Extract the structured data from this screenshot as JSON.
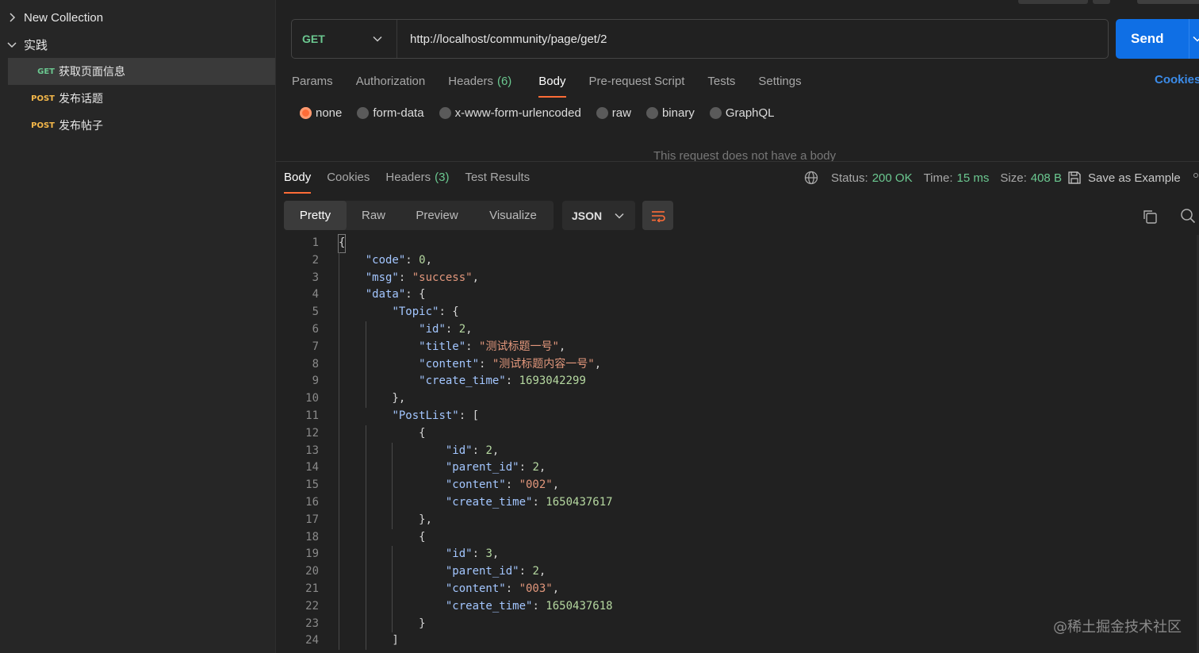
{
  "sidebar": {
    "collections": [
      {
        "label": "New Collection",
        "expanded": false
      },
      {
        "label": "实践",
        "expanded": true
      }
    ],
    "requests": [
      {
        "method": "GET",
        "name": "获取页面信息",
        "active": true
      },
      {
        "method": "POST",
        "name": "发布话题",
        "active": false
      },
      {
        "method": "POST",
        "name": "发布帖子",
        "active": false
      }
    ]
  },
  "request": {
    "method": "GET",
    "url": "http://localhost/community/page/get/2",
    "send_label": "Send"
  },
  "request_tabs": {
    "params": "Params",
    "authorization": "Authorization",
    "headers": "Headers",
    "headers_count": "(6)",
    "body": "Body",
    "pre_request": "Pre-request Script",
    "tests": "Tests",
    "settings": "Settings",
    "cookies": "Cookies"
  },
  "body_types": {
    "none": "none",
    "form_data": "form-data",
    "urlencoded": "x-www-form-urlencoded",
    "raw": "raw",
    "binary": "binary",
    "graphql": "GraphQL",
    "selected": "none"
  },
  "no_body_message": "This request does not have a body",
  "response_tabs": {
    "body": "Body",
    "cookies": "Cookies",
    "headers": "Headers",
    "headers_count": "(3)",
    "test_results": "Test Results"
  },
  "response_meta": {
    "status_label": "Status:",
    "status_value": "200 OK",
    "time_label": "Time:",
    "time_value": "15 ms",
    "size_label": "Size:",
    "size_value": "408 B",
    "save_example": "Save as Example"
  },
  "view_modes": {
    "pretty": "Pretty",
    "raw": "Raw",
    "preview": "Preview",
    "visualize": "Visualize",
    "format": "JSON"
  },
  "code_lines": [
    "{",
    "    \"code\": 0,",
    "    \"msg\": \"success\",",
    "    \"data\": {",
    "        \"Topic\": {",
    "            \"id\": 2,",
    "            \"title\": \"测试标题一号\",",
    "            \"content\": \"测试标题内容一号\",",
    "            \"create_time\": 1693042299",
    "        },",
    "        \"PostList\": [",
    "            {",
    "                \"id\": 2,",
    "                \"parent_id\": 2,",
    "                \"content\": \"002\",",
    "                \"create_time\": 1650437617",
    "            },",
    "            {",
    "                \"id\": 3,",
    "                \"parent_id\": 2,",
    "                \"content\": \"003\",",
    "                \"create_time\": 1650437618",
    "            }",
    "        ]"
  ],
  "watermark": "@稀土掘金技术社区",
  "colors": {
    "accent": "#ff6c37",
    "send": "#0f6fe5",
    "success": "#6bc890",
    "get": "#6bc890",
    "post": "#f5b84a",
    "link": "#3b8be8"
  }
}
